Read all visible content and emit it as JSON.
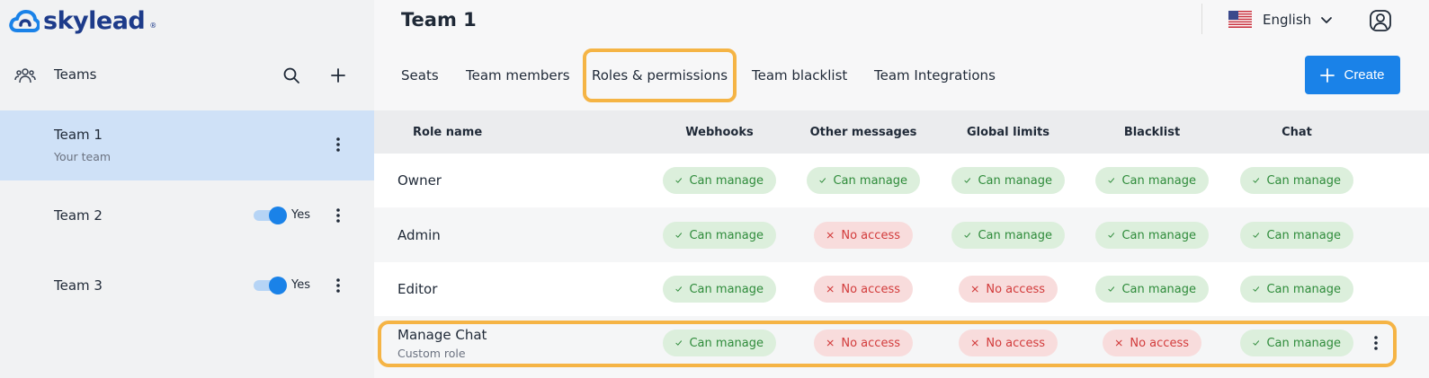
{
  "brand": {
    "name": "skylead",
    "reg": "®",
    "color": "#1d3b8a"
  },
  "sidebar": {
    "section_title": "Teams",
    "teams": [
      {
        "name": "Team 1",
        "subtitle": "Your team",
        "active": true
      },
      {
        "name": "Team 2",
        "toggle_label": "Yes",
        "toggle_on": true
      },
      {
        "name": "Team 3",
        "toggle_label": "Yes",
        "toggle_on": true
      }
    ]
  },
  "header": {
    "title": "Team 1",
    "language": "English",
    "create_label": "Create"
  },
  "tabs": [
    {
      "label": "Seats"
    },
    {
      "label": "Team members"
    },
    {
      "label": "Roles & permissions",
      "highlighted": true
    },
    {
      "label": "Team blacklist"
    },
    {
      "label": "Team Integrations"
    }
  ],
  "table": {
    "columns": [
      "Role name",
      "Webhooks",
      "Other messages",
      "Global limits",
      "Blacklist",
      "Chat"
    ],
    "rows": [
      {
        "name": "Owner",
        "subtitle": "",
        "cells": [
          "Can manage",
          "Can manage",
          "Can manage",
          "Can manage",
          "Can manage"
        ],
        "status": [
          "ok",
          "ok",
          "ok",
          "ok",
          "ok"
        ]
      },
      {
        "name": "Admin",
        "subtitle": "",
        "cells": [
          "Can manage",
          "No access",
          "Can manage",
          "Can manage",
          "Can manage"
        ],
        "status": [
          "ok",
          "no",
          "ok",
          "ok",
          "ok"
        ]
      },
      {
        "name": "Editor",
        "subtitle": "",
        "cells": [
          "Can manage",
          "No access",
          "No access",
          "Can manage",
          "Can manage"
        ],
        "status": [
          "ok",
          "no",
          "no",
          "ok",
          "ok"
        ]
      },
      {
        "name": "Manage Chat",
        "subtitle": "Custom role",
        "cells": [
          "Can manage",
          "No access",
          "No access",
          "No access",
          "Can manage"
        ],
        "status": [
          "ok",
          "no",
          "no",
          "no",
          "ok"
        ],
        "highlighted": true
      }
    ]
  },
  "colors": {
    "accent": "#1a82e8",
    "highlight": "#f5b445",
    "ok_bg": "#dcefdc",
    "ok_text": "#2e8b3a",
    "no_bg": "#f8dcdc",
    "no_text": "#d23b3b",
    "active_team_bg": "#cfe1f7"
  }
}
